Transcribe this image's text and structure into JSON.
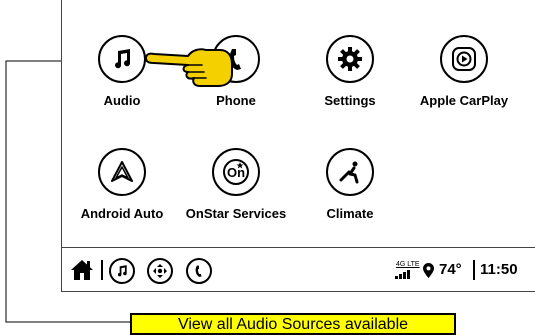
{
  "apps": [
    {
      "id": "audio",
      "label": "Audio",
      "icon": "music-note-icon"
    },
    {
      "id": "phone",
      "label": "Phone",
      "icon": "phone-icon"
    },
    {
      "id": "settings",
      "label": "Settings",
      "icon": "gear-icon"
    },
    {
      "id": "carplay",
      "label": "Apple CarPlay",
      "icon": "carplay-icon"
    },
    {
      "id": "android-auto",
      "label": "Android Auto",
      "icon": "android-auto-icon"
    },
    {
      "id": "onstar",
      "label": "OnStar Services",
      "icon": "onstar-icon"
    },
    {
      "id": "climate",
      "label": "Climate",
      "icon": "seat-heat-icon"
    }
  ],
  "status": {
    "network": "4G LTE",
    "temperature": "74°",
    "time": "11:50"
  },
  "callout": {
    "text": "View all Audio Sources available"
  },
  "colors": {
    "callout_bg": "#ffff00",
    "hand": "#f5d000"
  }
}
